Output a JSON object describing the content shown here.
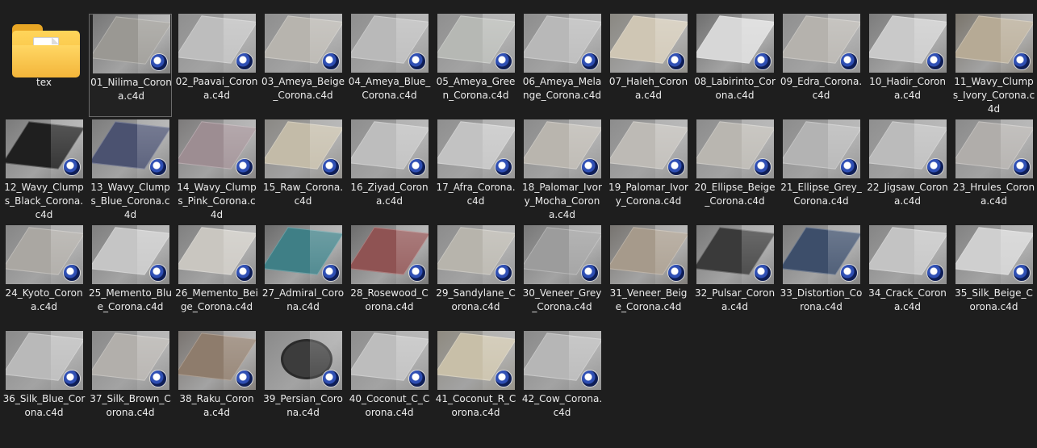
{
  "folder": {
    "label": "tex",
    "icon": "folder-icon"
  },
  "files": [
    {
      "label": "01_Nilima_Corona.c4d",
      "rug": "#9a9893",
      "floor": "#767676"
    },
    {
      "label": "02_Paavai_Corona.c4d",
      "rug": "#bdbdbd",
      "floor": "#8f8f8f"
    },
    {
      "label": "03_Ameya_Beige_Corona.c4d",
      "rug": "#b7b4ae",
      "floor": "#8e8e8e"
    },
    {
      "label": "04_Ameya_Blue_Corona.c4d",
      "rug": "#b9b9b9",
      "floor": "#8f8f8f"
    },
    {
      "label": "05_Ameya_Green_Corona.c4d",
      "rug": "#b6b8b4",
      "floor": "#8f8f8f"
    },
    {
      "label": "06_Ameya_Melange_Corona.c4d",
      "rug": "#b8b8b8",
      "floor": "#8d8d8d"
    },
    {
      "label": "07_Haleh_Corona.c4d",
      "rug": "#cfc6b4",
      "floor": "#8a8882"
    },
    {
      "label": "08_Labirinto_Corona.c4d",
      "rug": "#d7d7d7",
      "floor": "#6f6f6f"
    },
    {
      "label": "09_Edra_Corona.c4d",
      "rug": "#b5b2ad",
      "floor": "#8f8f8f"
    },
    {
      "label": "10_Hadir_Corona.c4d",
      "rug": "#c9c9c9",
      "floor": "#7c7c7c"
    },
    {
      "label": "11_Wavy_Clumps_Ivory_Corona.c4d",
      "rug": "#b6aa95",
      "floor": "#7a756c"
    },
    {
      "label": "12_Wavy_Clumps_Black_Corona.c4d",
      "rug": "#1f1f1f",
      "floor": "#7a7a7a"
    },
    {
      "label": "13_Wavy_Clumps_Blue_Corona.c4d",
      "rug": "#4b5270",
      "floor": "#7c7c7c"
    },
    {
      "label": "14_Wavy_Clumps_Pink_Corona.c4d",
      "rug": "#9d8d92",
      "floor": "#7d7b7b"
    },
    {
      "label": "15_Raw_Corona.c4d",
      "rug": "#c3bba8",
      "floor": "#8a8884"
    },
    {
      "label": "16_Ziyad_Corona.c4d",
      "rug": "#bdbdbd",
      "floor": "#8e8e8e"
    },
    {
      "label": "17_Afra_Corona.c4d",
      "rug": "#c2c2c2",
      "floor": "#8f8f8f"
    },
    {
      "label": "18_Palomar_Ivory_Mocha_Corona.c4d",
      "rug": "#b9b5ae",
      "floor": "#8b8b8b"
    },
    {
      "label": "19_Palomar_Ivory_Corona.c4d",
      "rug": "#bdbab5",
      "floor": "#8d8d8d"
    },
    {
      "label": "20_Ellipse_Beige_Corona.c4d",
      "rug": "#b9b6b0",
      "floor": "#8c8c8c"
    },
    {
      "label": "21_Ellipse_Grey_Corona.c4d",
      "rug": "#b3b3b3",
      "floor": "#8c8c8c"
    },
    {
      "label": "22_Jigsaw_Corona.c4d",
      "rug": "#bbbbbb",
      "floor": "#8f8f8f"
    },
    {
      "label": "23_Hrules_Corona.c4d",
      "rug": "#b0adaa",
      "floor": "#8a8a8a"
    },
    {
      "label": "24_Kyoto_Corona.c4d",
      "rug": "#aaa7a2",
      "floor": "#868686"
    },
    {
      "label": "25_Memento_Blue_Corona.c4d",
      "rug": "#c5c5c5",
      "floor": "#7f7f7f"
    },
    {
      "label": "26_Memento_Beige_Corona.c4d",
      "rug": "#c9c6c0",
      "floor": "#808080"
    },
    {
      "label": "27_Admiral_Corona.c4d",
      "rug": "#3f7f86",
      "floor": "#6c6c6c"
    },
    {
      "label": "28_Rosewood_Corona.c4d",
      "rug": "#8f5353",
      "floor": "#6d6d6d"
    },
    {
      "label": "29_Sandylane_Corona.c4d",
      "rug": "#b7b4ac",
      "floor": "#8c8c8c"
    },
    {
      "label": "30_Veneer_Grey_Corona.c4d",
      "rug": "#9c9c9c",
      "floor": "#787878"
    },
    {
      "label": "31_Veneer_Beige_Corona.c4d",
      "rug": "#a69a8b",
      "floor": "#777470"
    },
    {
      "label": "32_Pulsar_Corona.c4d",
      "rug": "#3a3a3a",
      "floor": "#7a7a7a"
    },
    {
      "label": "33_Distortion_Corona.c4d",
      "rug": "#3d4e6a",
      "floor": "#7b7b7b"
    },
    {
      "label": "34_Crack_Corona.c4d",
      "rug": "#c3c3c3",
      "floor": "#858585"
    },
    {
      "label": "35_Silk_Beige_Corona.c4d",
      "rug": "#cfcfcf",
      "floor": "#828282"
    },
    {
      "label": "36_Silk_Blue_Corona.c4d",
      "rug": "#b9b9b9",
      "floor": "#8b8b8b"
    },
    {
      "label": "37_Silk_Brown_Corona.c4d",
      "rug": "#b2afab",
      "floor": "#898989"
    },
    {
      "label": "38_Raku_Corona.c4d",
      "rug": "#8e7c6c",
      "floor": "#797470"
    },
    {
      "label": "39_Persian_Corona.c4d",
      "rug": "#3c3c3c",
      "floor": "#8a8a8a",
      "round": true
    },
    {
      "label": "40_Coconut_C_Corona.c4d",
      "rug": "#bdbdbd",
      "floor": "#8e8e8e"
    },
    {
      "label": "41_Coconut_R_Corona.c4d",
      "rug": "#c8bfa8",
      "floor": "#8e8a80"
    },
    {
      "label": "42_Cow_Corona.c4d",
      "rug": "#b6b6b6",
      "floor": "#8a8a8a"
    }
  ],
  "selected_index": 0,
  "file_type_icon": "cinema4d-icon"
}
